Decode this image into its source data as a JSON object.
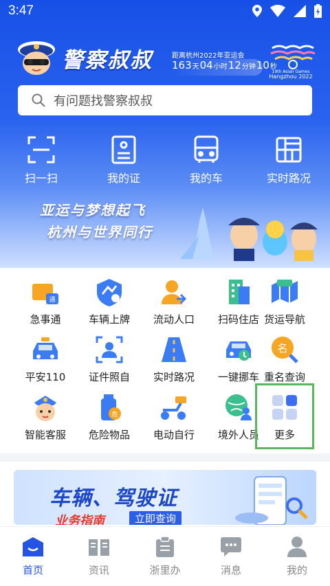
{
  "status_bar": {
    "time": "3:47"
  },
  "header": {
    "app_title": "警察叔叔",
    "countdown": {
      "caption": "距离杭州2022年亚运会",
      "days": "163",
      "days_unit": "天",
      "hours": "04",
      "hours_unit": "小时",
      "minutes": "12",
      "minutes_unit": "分钟",
      "seconds": "10",
      "seconds_unit": "秒"
    },
    "games_logo": {
      "line1": "19th Asian Games",
      "line2": "Hangzhou 2022"
    }
  },
  "search": {
    "placeholder": "有问题找警察叔叔"
  },
  "quick_actions": [
    {
      "label": "扫一扫",
      "icon": "scan-icon"
    },
    {
      "label": "我的证",
      "icon": "id-card-icon"
    },
    {
      "label": "我的车",
      "icon": "car-front-icon"
    },
    {
      "label": "实时路况",
      "icon": "traffic-map-icon"
    }
  ],
  "banner": {
    "line1": "亚运与梦想起飞",
    "line2": "杭州与世界同行"
  },
  "services": [
    {
      "label": "急事通",
      "icon": "urgent-truck-icon"
    },
    {
      "label": "车辆上牌",
      "icon": "license-plate-icon"
    },
    {
      "label": "流动人口",
      "icon": "migrant-person-icon"
    },
    {
      "label": "扫码住店",
      "icon": "hotel-icon"
    },
    {
      "label": "货运导航",
      "icon": "freight-map-icon"
    },
    {
      "label": "平安110",
      "icon": "police-car-icon"
    },
    {
      "label": "证件照自",
      "icon": "id-photo-icon"
    },
    {
      "label": "实时路况",
      "icon": "road-icon"
    },
    {
      "label": "一键挪车",
      "icon": "move-car-icon"
    },
    {
      "label": "重名查询",
      "icon": "name-search-icon"
    },
    {
      "label": "智能客服",
      "icon": "police-avatar-icon"
    },
    {
      "label": "危险物品",
      "icon": "hazard-bottle-icon"
    },
    {
      "label": "电动自行",
      "icon": "ebike-icon"
    },
    {
      "label": "境外人员",
      "icon": "globe-person-icon"
    },
    {
      "label": "更多",
      "icon": "more-grid-icon"
    }
  ],
  "promo": {
    "title": "车辆、驾驶证",
    "sub_red": "业务指南",
    "sub_btn": "立即查询"
  },
  "tabbar": [
    {
      "label": "首页",
      "icon": "home-icon",
      "active": true
    },
    {
      "label": "资讯",
      "icon": "news-book-icon",
      "active": false
    },
    {
      "label": "浙里办",
      "icon": "clipboard-icon",
      "active": false
    },
    {
      "label": "消息",
      "icon": "message-icon",
      "active": false
    },
    {
      "label": "我的",
      "icon": "profile-icon",
      "active": false
    }
  ],
  "colors": {
    "primary": "#2454e6",
    "highlight": "#5bb55f"
  }
}
